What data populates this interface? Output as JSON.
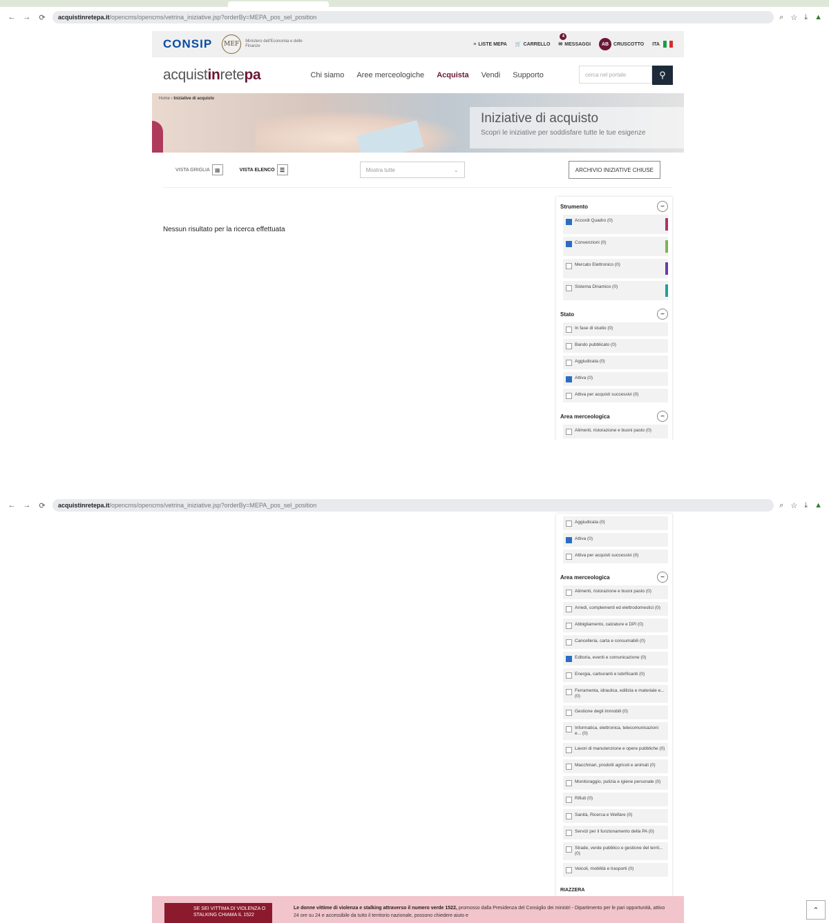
{
  "browser": {
    "url_host": "acquistinretepa.it",
    "url_path": "/opencms/opencms/vetrina_iniziative.jsp?orderBy=MEPA_pos_sel_position",
    "nav": {
      "back": "←",
      "forward": "→",
      "reload": "⟳"
    }
  },
  "header": {
    "consip": "CONSIP",
    "mef_seal": "MEF",
    "mef_text": "Ministero dell'Economia e delle Finanze",
    "util_links": [
      {
        "icon": "≡",
        "label": "LISTE MEPA"
      },
      {
        "icon": "🛒",
        "label": "CARRELLO"
      },
      {
        "icon": "✉",
        "label": "MESSAGGI",
        "badge": "4"
      },
      {
        "icon": "",
        "label": "CRUSCOTTO",
        "avatar": "AB"
      }
    ],
    "lang": "ITA"
  },
  "nav": {
    "logo_a": "acquist",
    "logo_b": "in",
    "logo_c": "rete",
    "logo_d": "pa",
    "items": [
      "Chi siamo",
      "Aree merceologiche",
      "Acquista",
      "Vendi",
      "Supporto"
    ],
    "search_placeholder": "cerca nel portale"
  },
  "breadcrumb": {
    "home": "Home",
    "current": "Iniziative di acquisto"
  },
  "hero": {
    "title": "Iniziative di acquisto",
    "subtitle": "Scopri le iniziative per soddisfare tutte le tue esigenze"
  },
  "controls": {
    "view_grid": "VISTA GRIGLIA",
    "view_list": "VISTA ELENCO",
    "sort": "Mostra tutte",
    "archive": "ARCHIVIO INIZIATIVE CHIUSE"
  },
  "results": {
    "empty": "Nessun risultato per la ricerca effettuata"
  },
  "filters": {
    "strumento": {
      "title": "Strumento",
      "options": [
        {
          "label": "Accordi Quadro (0)",
          "checked": true,
          "color": "#b0306a"
        },
        {
          "label": "Convenzioni (0)",
          "checked": true,
          "color": "#7ab648"
        },
        {
          "label": "Mercato Elettronico (0)",
          "checked": false,
          "color": "#6b3aa8"
        },
        {
          "label": "Sistema Dinamico (0)",
          "checked": false,
          "color": "#1aa39a"
        }
      ]
    },
    "stato": {
      "title": "Stato",
      "options": [
        {
          "label": "In fase di studio (0)",
          "checked": false
        },
        {
          "label": "Bando pubblicato (0)",
          "checked": false
        },
        {
          "label": "Aggiudicata (0)",
          "checked": false
        },
        {
          "label": "Attiva (0)",
          "checked": true
        },
        {
          "label": "Attiva per acquisti successivi (0)",
          "checked": false
        }
      ]
    },
    "area": {
      "title": "Area merceologica",
      "options": [
        {
          "label": "Alimenti, ristorazione e buoni pasto (0)",
          "checked": false
        },
        {
          "label": "Arredi, complementi ed elettrodomestici (0)",
          "checked": false
        },
        {
          "label": "Abbigliamento, calzature e DPI (0)",
          "checked": false
        },
        {
          "label": "Cancelleria, carta e consumabili (0)",
          "checked": false
        },
        {
          "label": "Editoria, eventi e comunicazione (0)",
          "checked": true
        },
        {
          "label": "Energia, carburanti e lubrificanti (0)",
          "checked": false
        },
        {
          "label": "Ferramenta, idraulica, edilizia e materiale e... (0)",
          "checked": false
        },
        {
          "label": "Gestione degli immobili (0)",
          "checked": false
        },
        {
          "label": "Informatica, elettronica, telecomunicazioni e... (0)",
          "checked": false
        },
        {
          "label": "Lavori di manutenzione e opere pubbliche (0)",
          "checked": false
        },
        {
          "label": "Macchinari, prodotti agricoli e animali (0)",
          "checked": false
        },
        {
          "label": "Monitoraggio, pulizia e igiene personale (0)",
          "checked": false
        },
        {
          "label": "Rifiuti (0)",
          "checked": false
        },
        {
          "label": "Sanità, Ricerca e Welfare (0)",
          "checked": false
        },
        {
          "label": "Servizi per il funzionamento della PA (0)",
          "checked": false
        },
        {
          "label": "Strade, verde pubblico e gestione del territ... (0)",
          "checked": false
        },
        {
          "label": "Veicoli, mobilità e trasporti (0)",
          "checked": false
        }
      ]
    },
    "reset": "RIAZZERA"
  },
  "banner": {
    "box": "SE SEI VITTIMA DI VIOLENZA O STALKING CHIAMA IL 1522",
    "text_bold": "Le donne vittime di violenza e stalking attraverso il numero verde 1522,",
    "text_rest": " promosso dalla Presidenza del Consiglio dei ministri - Dipartimento per le pari opportunità, attivo 24 ore su 24 e accessibile da tutto il territorio nazionale, possono chiedere aiuto e"
  },
  "totop": "⌃",
  "colors": {
    "brand": "#6b1737",
    "consip": "#0a4da2",
    "checkbox": "#2b6dc2"
  }
}
